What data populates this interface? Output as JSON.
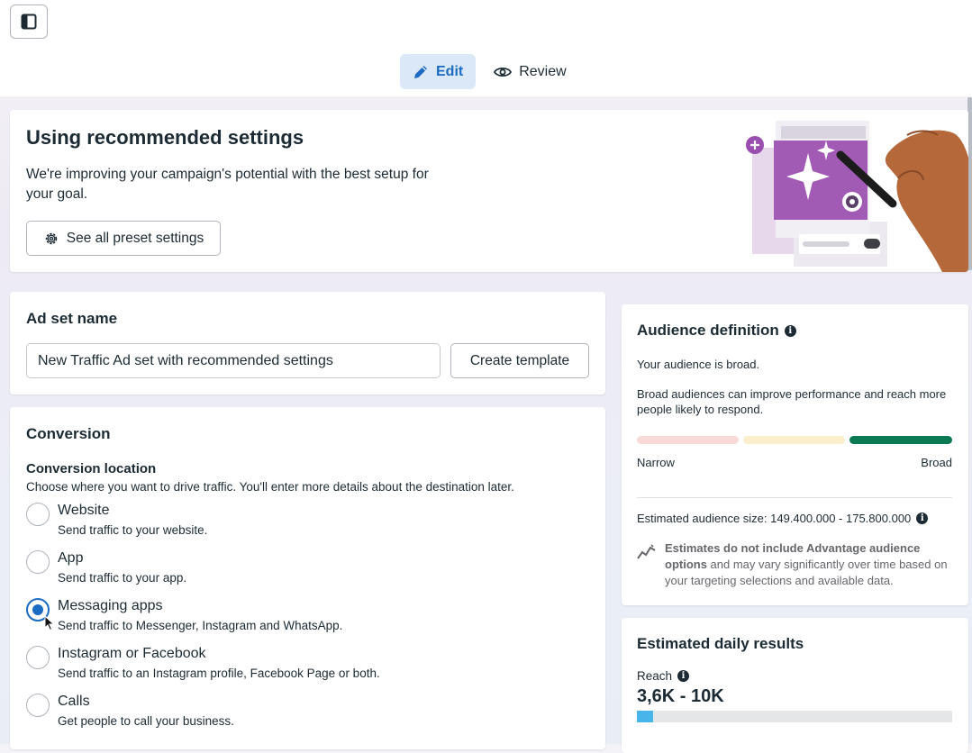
{
  "header": {
    "tabs": [
      {
        "label": "Edit",
        "icon": "pencil-icon",
        "active": true
      },
      {
        "label": "Review",
        "icon": "eye-icon",
        "active": false
      }
    ]
  },
  "banner": {
    "title": "Using recommended settings",
    "description": "We're improving your campaign's potential with the best setup for your goal.",
    "button_label": "See all preset settings"
  },
  "adset": {
    "title": "Ad set name",
    "name_value": "New Traffic Ad set with recommended settings",
    "template_button": "Create template"
  },
  "conversion": {
    "title": "Conversion",
    "location_title": "Conversion location",
    "location_desc": "Choose where you want to drive traffic. You'll enter more details about the destination later.",
    "options": [
      {
        "label": "Website",
        "sub": "Send traffic to your website.",
        "selected": false
      },
      {
        "label": "App",
        "sub": "Send traffic to your app.",
        "selected": false
      },
      {
        "label": "Messaging apps",
        "sub": "Send traffic to Messenger, Instagram and WhatsApp.",
        "selected": true
      },
      {
        "label": "Instagram or Facebook",
        "sub": "Send traffic to an Instagram profile, Facebook Page or both.",
        "selected": false
      },
      {
        "label": "Calls",
        "sub": "Get people to call your business.",
        "selected": false
      }
    ]
  },
  "audience": {
    "title": "Audience definition",
    "status": "Your audience is broad.",
    "explain": "Broad audiences can improve performance and reach more people likely to respond.",
    "narrow_label": "Narrow",
    "broad_label": "Broad",
    "size_text": "Estimated audience size: 149.400.000 - 175.800.000",
    "note_bold": "Estimates do not include Advantage audience options",
    "note_rest": " and may vary significantly over time based on your targeting selections and available data.",
    "meter_colors": [
      "#f9d8d8",
      "#fbeecb",
      "#0b7a53"
    ]
  },
  "daily": {
    "title": "Estimated daily results",
    "reach_label": "Reach",
    "reach_value": "3,6K - 10K"
  },
  "colors": {
    "accent": "#1b6bc2",
    "accent_bg": "#dbe8f7",
    "reach_fill": "#47b4ea"
  }
}
